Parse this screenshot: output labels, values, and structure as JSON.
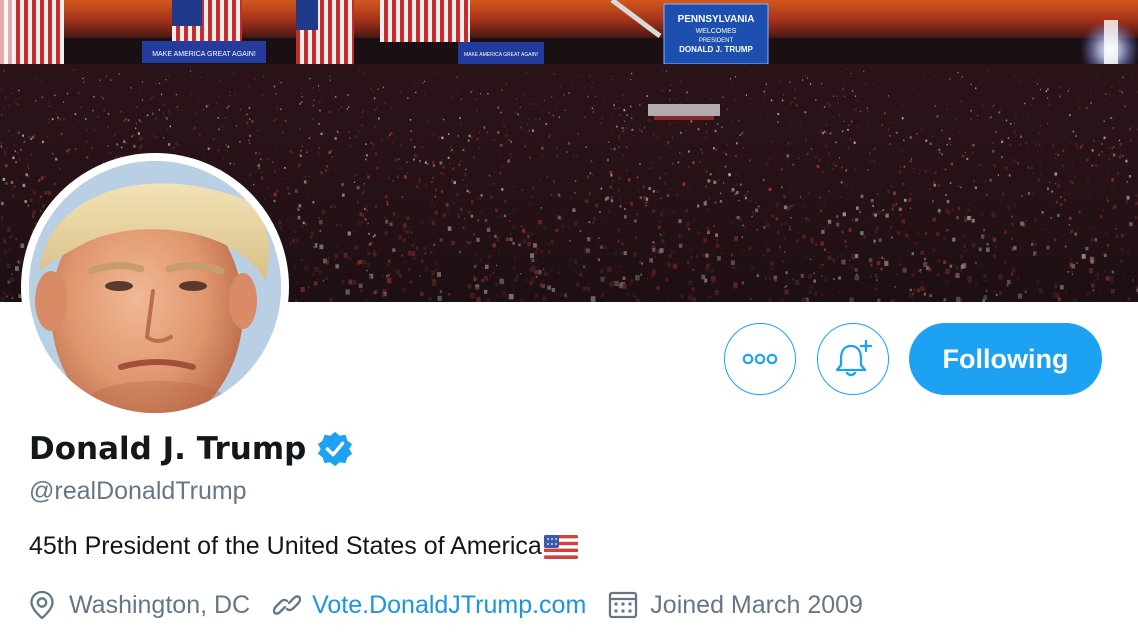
{
  "banner": {
    "signs": [
      "MAKE AMERICA GREAT AGAIN!",
      "MAKE AMERICA GREAT AGAIN!"
    ],
    "screen_lines": [
      "PENNSYLVANIA",
      "WELCOMES",
      "PRESIDENT",
      "DONALD J. TRUMP"
    ]
  },
  "actions": {
    "more_icon": "more-horizontal-icon",
    "notify_icon": "bell-plus-icon",
    "following_label": "Following"
  },
  "profile": {
    "name": "Donald J. Trump",
    "verified_icon": "verified-badge-icon",
    "handle": "@realDonaldTrump",
    "bio": "45th President of the United States of America",
    "bio_emoji": "us-flag-emoji",
    "location": "Washington, DC",
    "website": "Vote.DonaldJTrump.com",
    "joined": "Joined March 2009"
  },
  "colors": {
    "accent": "#1da1f2",
    "link": "#1b95e0",
    "text": "#14171a",
    "muted": "#657786"
  }
}
